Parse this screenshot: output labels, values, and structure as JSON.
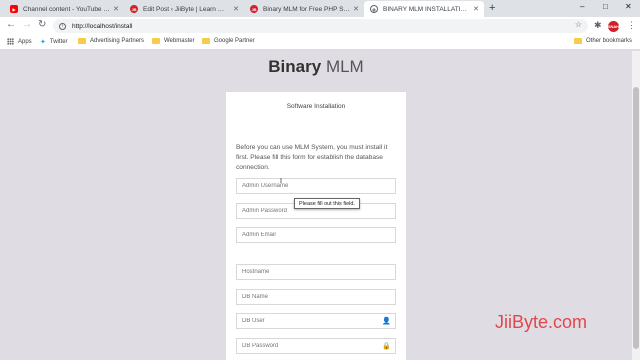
{
  "browser": {
    "tabs": [
      {
        "title": "Channel content - YouTube Studio",
        "favicon": "youtube-icon",
        "color": "#ff0000"
      },
      {
        "title": "Edit Post ‹ JiiByte | Learn Web Dev",
        "favicon": "jiibyte-icon",
        "color": "#d0212a"
      },
      {
        "title": "Binary MLM for Free PHP Script",
        "favicon": "jiibyte-icon",
        "color": "#d0212a"
      },
      {
        "title": "BINARY MLM INSTALLATION",
        "favicon": "globe-icon",
        "color": "#5f6368",
        "active": true
      }
    ],
    "new_tab": "+",
    "window_controls": {
      "minimize": "–",
      "maximize": "□",
      "close": "✕"
    },
    "url": "http://localhost/install",
    "avatar_text": "SNAH"
  },
  "bookmarks": [
    {
      "label": "Apps",
      "icon": "apps-grid-icon"
    },
    {
      "label": "Twitter",
      "icon": "twitter-icon"
    },
    {
      "label": "Advertising Partners",
      "icon": "folder-icon"
    },
    {
      "label": "Webmaster",
      "icon": "folder-icon"
    },
    {
      "label": "Google Partner",
      "icon": "folder-icon"
    }
  ],
  "other_bookmarks": "Other bookmarks",
  "page": {
    "brand_bold": "Binary",
    "brand_light": "MLM",
    "card_title": "Software Installation",
    "intro": "Before you can use MLM System, you must install it first. Please fill this form for establish the database connection.",
    "fields": {
      "admin_username": "Admin Username",
      "admin_password": "Admin Password",
      "admin_email": "Admin Email",
      "hostname": "Hostname",
      "db_name": "DB Name",
      "db_user": "DB User",
      "db_password": "DB Password"
    },
    "tooltip": "Please fill out this field."
  },
  "watermark": "JiiByte.com"
}
